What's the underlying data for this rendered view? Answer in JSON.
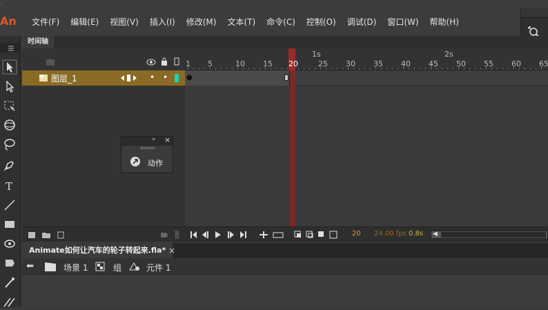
{
  "app": {
    "logo": "An"
  },
  "menu": [
    "文件(F)",
    "编辑(E)",
    "视图(V)",
    "插入(I)",
    "修改(M)",
    "文本(T)",
    "命令(C)",
    "控制(O)",
    "调试(D)",
    "窗口(W)",
    "帮助(H)"
  ],
  "timeline": {
    "tab_label": "时间轴",
    "layer_name": "图层_1",
    "seconds": [
      "1s",
      "2s"
    ],
    "ticks": [
      "1",
      "5",
      "10",
      "15",
      "20",
      "25",
      "30",
      "35",
      "40",
      "45",
      "50",
      "55",
      "60",
      "65"
    ],
    "current_frame": "20",
    "fps": "24.00 fps",
    "elapsed": "0.8s"
  },
  "popup": {
    "label": "动作"
  },
  "document": {
    "tab_title": "Animate如何让汽车的轮子转起来.fla*",
    "close": "×",
    "breadcrumb": {
      "scene": "场景 1",
      "group": "组",
      "symbol": "元件 1"
    }
  },
  "colors": {
    "layer_highlight": "#8a6a25",
    "playhead": "#9c2a2a",
    "current_frame_text": "#e8a020"
  }
}
